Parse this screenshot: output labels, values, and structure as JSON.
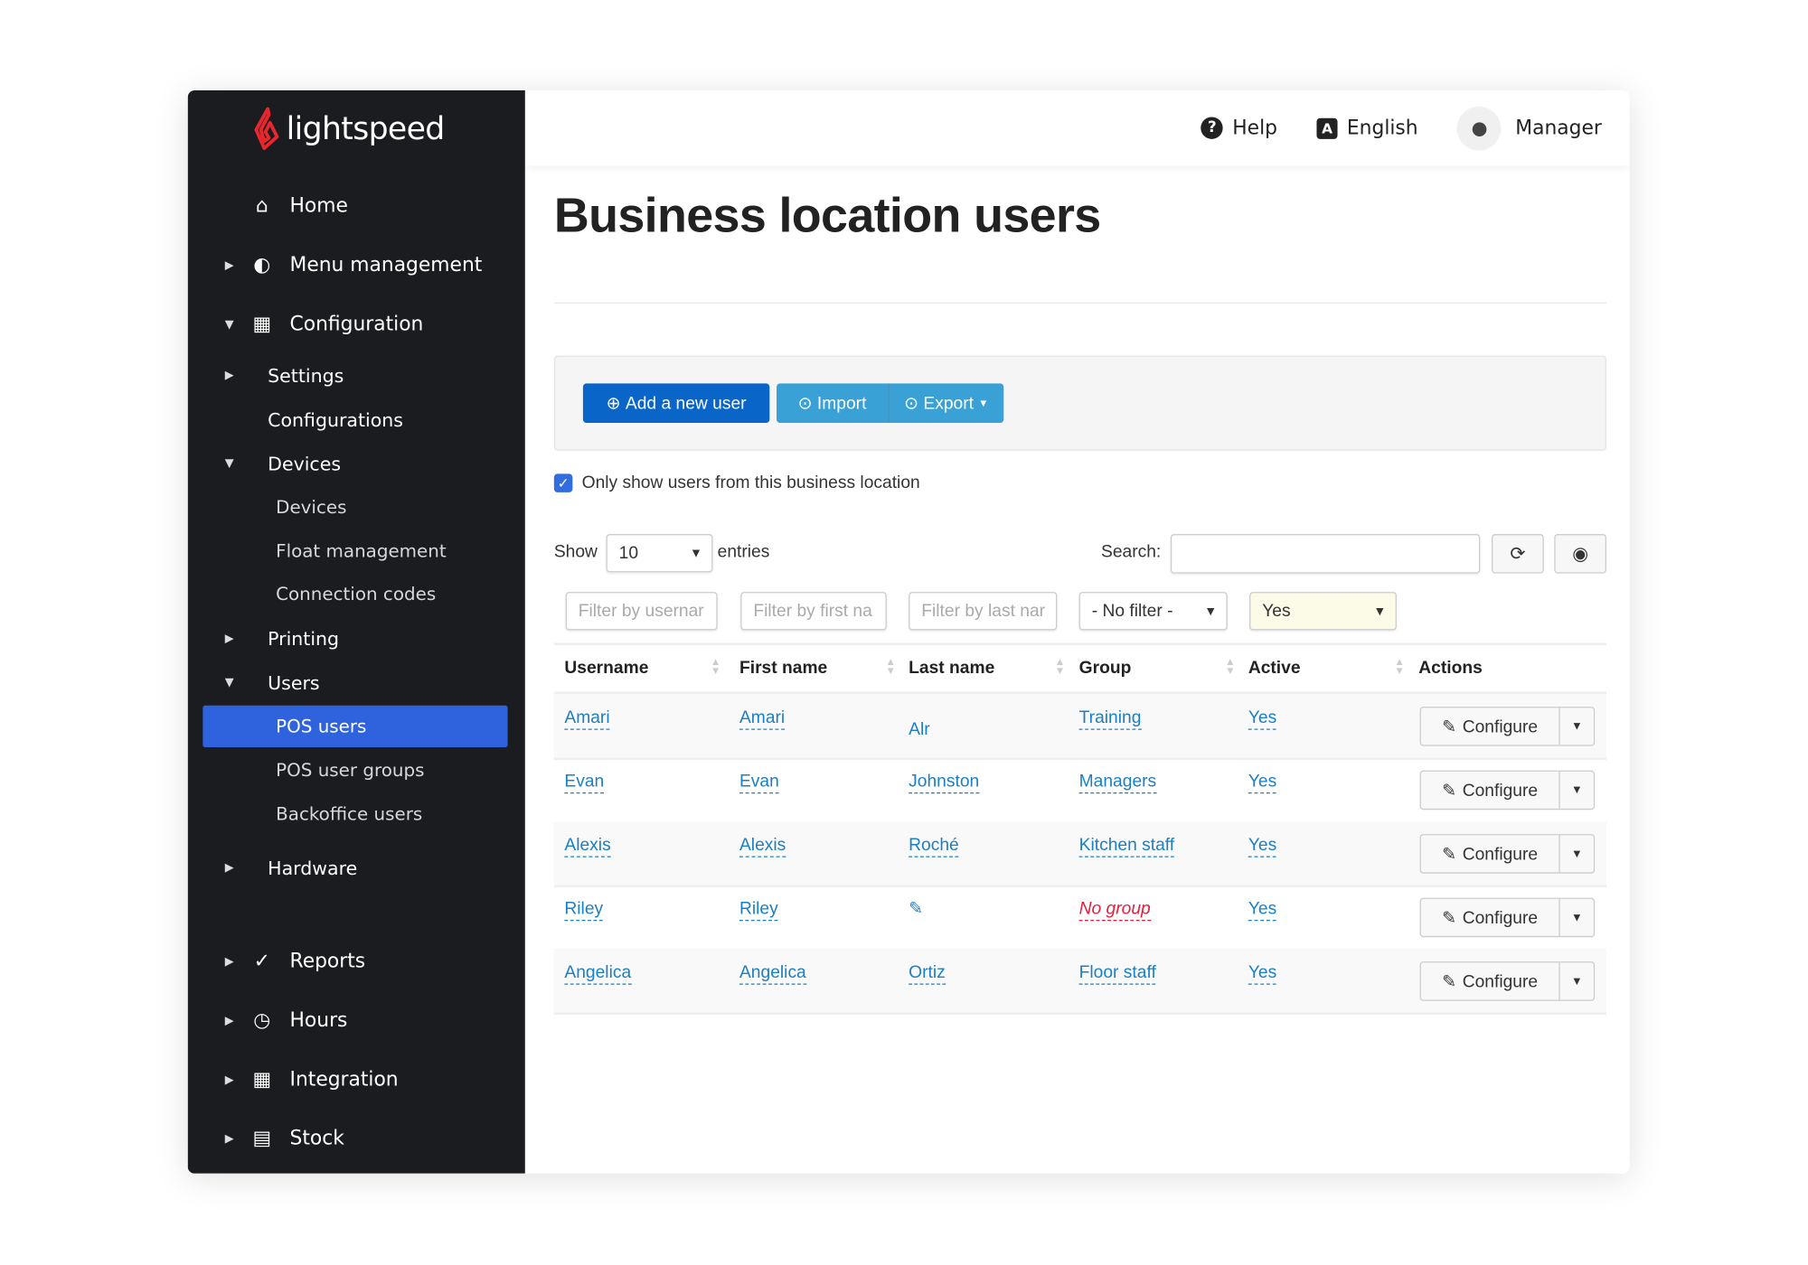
{
  "brand": {
    "name": "lightspeed",
    "logo_color": "#e8262d"
  },
  "header": {
    "help": "Help",
    "language": "English",
    "user": "Manager"
  },
  "sidebar": {
    "items": [
      {
        "label": "Home",
        "icon": "home-icon",
        "level": "top",
        "arrow": ""
      },
      {
        "label": "Menu management",
        "icon": "menu-icon",
        "level": "top",
        "arrow": "right"
      },
      {
        "label": "Configuration",
        "icon": "grid-check-icon",
        "level": "top",
        "arrow": "down"
      },
      {
        "label": "Settings",
        "level": "l2",
        "arrow": "right"
      },
      {
        "label": "Configurations",
        "level": "l2",
        "arrow": ""
      },
      {
        "label": "Devices",
        "level": "l2",
        "arrow": "down"
      },
      {
        "label": "Devices",
        "level": "l3",
        "arrow": ""
      },
      {
        "label": "Float management",
        "level": "l3",
        "arrow": ""
      },
      {
        "label": "Connection codes",
        "level": "l3",
        "arrow": ""
      },
      {
        "label": "Printing",
        "level": "l2",
        "arrow": "right"
      },
      {
        "label": "Users",
        "level": "l2",
        "arrow": "down"
      },
      {
        "label": "POS users",
        "level": "l3",
        "arrow": "",
        "active": true
      },
      {
        "label": "POS user groups",
        "level": "l3",
        "arrow": ""
      },
      {
        "label": "Backoffice users",
        "level": "l3",
        "arrow": ""
      },
      {
        "label": "Hardware",
        "level": "l2",
        "arrow": "right"
      },
      {
        "label": "Reports",
        "icon": "chart-icon",
        "level": "top",
        "arrow": "right"
      },
      {
        "label": "Hours",
        "icon": "clock-icon",
        "level": "top",
        "arrow": "right"
      },
      {
        "label": "Integration",
        "icon": "integration-icon",
        "level": "top",
        "arrow": "right"
      },
      {
        "label": "Stock",
        "icon": "stock-icon",
        "level": "top",
        "arrow": "right"
      }
    ]
  },
  "main": {
    "title": "Business location users",
    "toolbar": {
      "add": "Add a new user",
      "import": "Import",
      "export": "Export"
    },
    "only_location": {
      "label": "Only show users from this business location",
      "checked": true
    },
    "show": "Show",
    "entries_value": "10",
    "entries": "entries",
    "search_label": "Search:",
    "search_value": "",
    "filters": {
      "username": "Filter by usernar",
      "first": "Filter by first na",
      "last": "Filter by last nar",
      "group": "- No filter -",
      "active": "Yes"
    },
    "columns": [
      "Username",
      "First name",
      "Last name",
      "Group",
      "Active",
      "Actions"
    ],
    "rows": [
      {
        "username": "Amari",
        "first": "Amari",
        "last": "Alr",
        "group": "Training",
        "active": "Yes"
      },
      {
        "username": "Evan",
        "first": "Evan",
        "last": "Johnston",
        "group": "Managers",
        "active": "Yes"
      },
      {
        "username": "Alexis",
        "first": "Alexis",
        "last": "Roché",
        "group": "Kitchen staff",
        "active": "Yes"
      },
      {
        "username": "Riley",
        "first": "Riley",
        "last": "",
        "group": "No group",
        "active": "Yes",
        "no_group": true
      },
      {
        "username": "Angelica",
        "first": "Angelica",
        "last": "Ortiz",
        "group": "Floor staff",
        "active": "Yes"
      }
    ],
    "configure": "Configure"
  }
}
